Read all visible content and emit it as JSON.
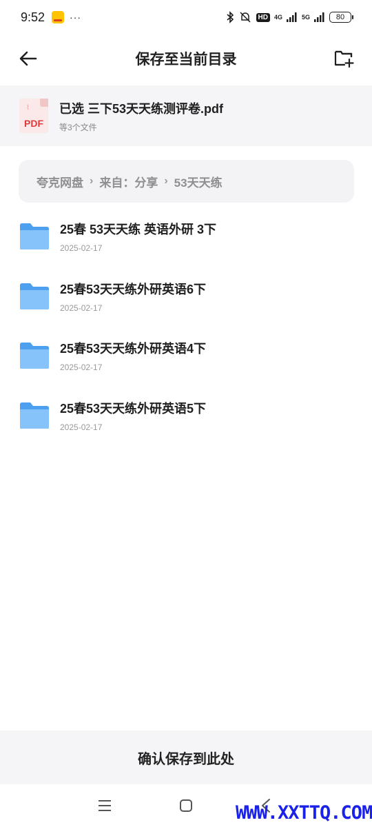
{
  "status_bar": {
    "time": "9:52",
    "dots": "···",
    "hd": "HD",
    "net1": "4G",
    "net2": "5G",
    "battery": "80"
  },
  "header": {
    "title": "保存至当前目录"
  },
  "selected": {
    "icon_label": "PDF",
    "name": "已选 三下53天天练测评卷.pdf",
    "sub": "等3个文件"
  },
  "breadcrumb": {
    "items": [
      "夸克网盘",
      "来自：分享",
      "53天天练"
    ],
    "separator": "›"
  },
  "folders": [
    {
      "name": "25春 53天天练 英语外研 3下",
      "date": "2025-02-17"
    },
    {
      "name": "25春53天天练外研英语6下",
      "date": "2025-02-17"
    },
    {
      "name": "25春53天天练外研英语4下",
      "date": "2025-02-17"
    },
    {
      "name": "25春53天天练外研英语5下",
      "date": "2025-02-17"
    }
  ],
  "confirm": {
    "label": "确认保存到此处"
  },
  "watermark": "WWW.XXTTQ.COM",
  "colors": {
    "folder": "#5aa8f0",
    "pdf_red": "#e03a3a",
    "panel_bg": "#f5f5f7"
  }
}
